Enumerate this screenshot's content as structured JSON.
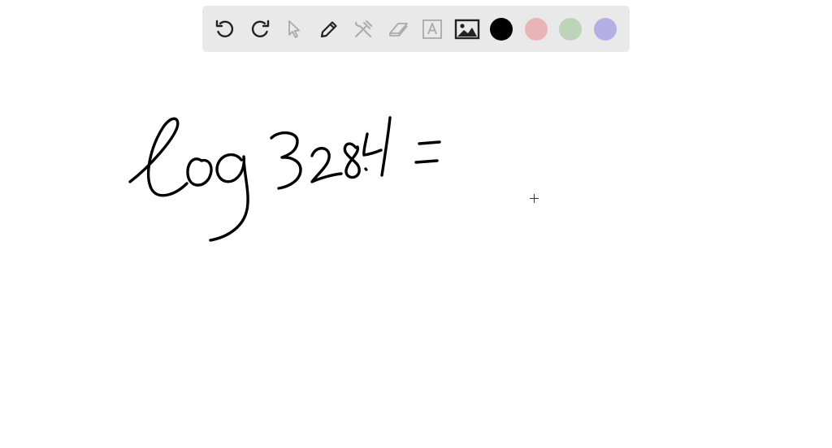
{
  "toolbar": {
    "tools": [
      {
        "name": "undo-icon",
        "enabled": true
      },
      {
        "name": "redo-icon",
        "enabled": true
      },
      {
        "name": "select-pointer-icon",
        "enabled": false
      },
      {
        "name": "pen-icon",
        "enabled": true
      },
      {
        "name": "tools-icon",
        "enabled": false
      },
      {
        "name": "eraser-icon",
        "enabled": false
      },
      {
        "name": "text-box-icon",
        "enabled": false
      },
      {
        "name": "image-icon",
        "enabled": true
      }
    ],
    "colors": {
      "black": "#000000",
      "red": "#e8b4b6",
      "green": "#bcd4b8",
      "purple": "#b4b0e6"
    },
    "icon_color_enabled": "#222222",
    "icon_color_disabled": "#aaaaaa"
  },
  "canvas": {
    "handwriting": "log 3284 ="
  }
}
